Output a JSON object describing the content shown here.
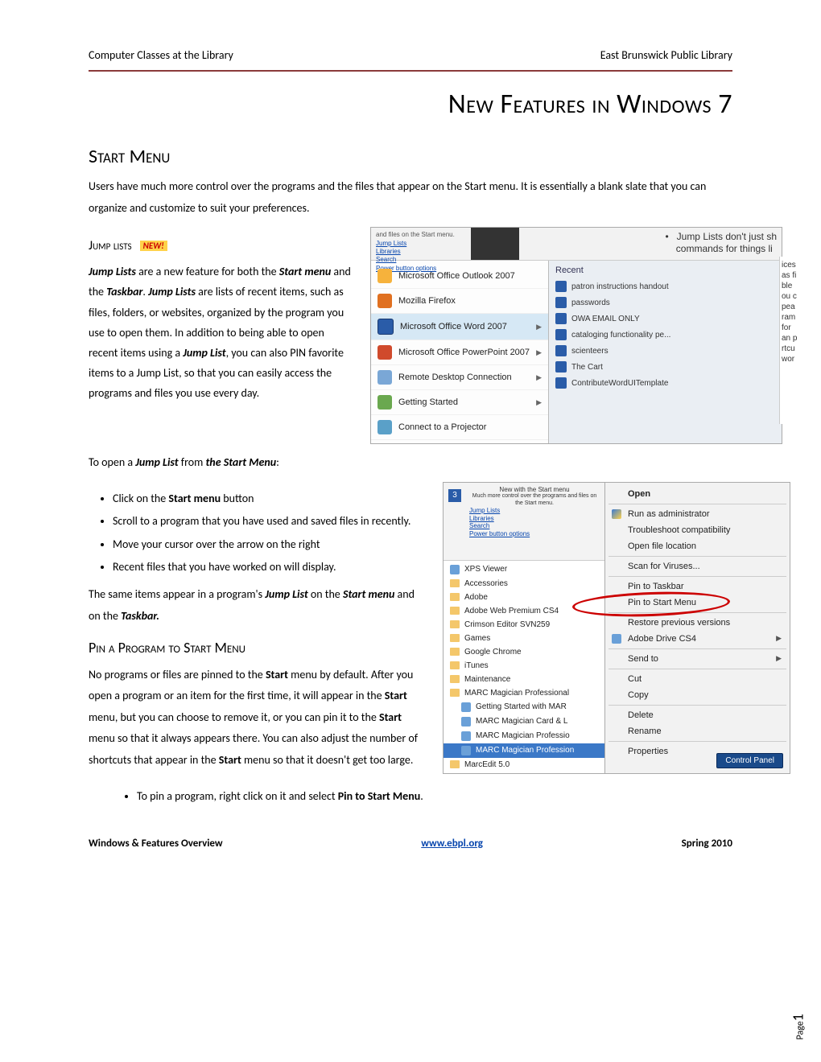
{
  "header": {
    "left": "Computer Classes at the Library",
    "right": "East Brunswick Public Library"
  },
  "title": "New Features in Windows 7",
  "sections": {
    "start_menu": {
      "heading": "Start Menu",
      "body": "Users have much more control over the programs and the files that appear on the Start menu.    It is essentially a blank slate that you can organize and customize to suit your preferences."
    },
    "jump_lists": {
      "heading": "Jump lists",
      "badge": "NEW!",
      "para": "Jump Lists are a new feature for both the Start menu and the Taskbar. Jump Lists are lists of recent items, such as files, folders, or websites, organized by the program you use to open them. In addition to being able to open recent items using a Jump List, you can also PIN favorite items to a Jump List, so that you can easily access the programs and files you use every day.",
      "to_open_label": "To open a Jump List from the Start Menu:",
      "steps": [
        "Click on the Start menu button",
        "Scroll to a program that you have used and saved files in recently.",
        "Move your cursor over the arrow on the right",
        "Recent files that you have worked on will display."
      ],
      "same_items": "The same items appear in a program's Jump List on the Start menu and on the Taskbar."
    },
    "pin": {
      "heading": "Pin a Program to Start Menu",
      "body": "No programs or files are pinned to the Start menu by default. After you open a program or an item for the first time, it will appear in the Start menu, but you can choose to remove it, or you can pin it to the Start menu so that it always appears there. You can also adjust the number of shortcuts that appear in the Start menu so that it doesn't get too large.",
      "step": "To pin a program, right click on it and select Pin to Start Menu."
    }
  },
  "shot1": {
    "topnote": "and files on the Start menu.",
    "toplinks": [
      "Jump Lists",
      "Libraries",
      "Search",
      "Power button options"
    ],
    "topright1": "Jump Lists don't just sh",
    "topright2": "commands for things li",
    "programs": [
      {
        "label": "Microsoft Office Outlook 2007",
        "icon": "ic-outlook",
        "arrow": false
      },
      {
        "label": "Mozilla Firefox",
        "icon": "ic-firefox",
        "arrow": false
      },
      {
        "label": "Microsoft Office Word 2007",
        "icon": "ic-word",
        "arrow": true,
        "hov": true
      },
      {
        "label": "Microsoft Office PowerPoint 2007",
        "icon": "ic-ppt",
        "arrow": true
      },
      {
        "label": "Remote Desktop Connection",
        "icon": "ic-rdp",
        "arrow": true
      },
      {
        "label": "Getting Started",
        "icon": "ic-gs",
        "arrow": true
      },
      {
        "label": "Connect to a Projector",
        "icon": "ic-proj",
        "arrow": false
      }
    ],
    "recent_heading": "Recent",
    "recent": [
      "patron instructions handout",
      "passwords",
      "OWA EMAIL ONLY",
      "cataloging functionality pe...",
      "scienteers",
      "The Cart",
      "ContributeWordUITemplate"
    ],
    "edge_words": [
      "ices",
      "as fi",
      "ble",
      "ou c",
      "pea",
      "ram",
      "for",
      "an p",
      "rtcu",
      "wor"
    ]
  },
  "shot2": {
    "topnum": "3",
    "toptitle": "New with the Start menu",
    "topsub": "Much more control over the programs and files on the Start menu.",
    "toplinks": [
      "Jump Lists",
      "Libraries",
      "Search",
      "Power button options"
    ],
    "left_items": [
      {
        "label": "XPS Viewer",
        "type": "app"
      },
      {
        "label": "Accessories",
        "type": "fld"
      },
      {
        "label": "Adobe",
        "type": "fld"
      },
      {
        "label": "Adobe Web Premium CS4",
        "type": "fld"
      },
      {
        "label": "Crimson Editor SVN259",
        "type": "fld"
      },
      {
        "label": "Games",
        "type": "fld"
      },
      {
        "label": "Google Chrome",
        "type": "fld"
      },
      {
        "label": "iTunes",
        "type": "fld"
      },
      {
        "label": "Maintenance",
        "type": "fld"
      },
      {
        "label": "MARC Magician Professional",
        "type": "fld"
      },
      {
        "label": "Getting Started with MAR",
        "type": "app",
        "indent": true
      },
      {
        "label": "MARC Magician Card & L",
        "type": "app",
        "indent": true
      },
      {
        "label": "MARC Magician Professio",
        "type": "app",
        "indent": true
      },
      {
        "label": "MARC Magician Profession",
        "type": "app",
        "indent": true,
        "sel": true
      },
      {
        "label": "MarcEdit 5.0",
        "type": "fld"
      }
    ],
    "ctx": [
      {
        "label": "Open",
        "bold": true
      },
      {
        "sep": true
      },
      {
        "label": "Run as administrator",
        "shield": true
      },
      {
        "label": "Troubleshoot compatibility"
      },
      {
        "label": "Open file location"
      },
      {
        "sep": true
      },
      {
        "label": "Scan for Viruses..."
      },
      {
        "sep": true
      },
      {
        "label": "Pin to Taskbar"
      },
      {
        "label": "Pin to Start Menu"
      },
      {
        "sep": true
      },
      {
        "label": "Restore previous versions"
      },
      {
        "label": "Adobe Drive CS4",
        "smic": true,
        "arrow": true
      },
      {
        "sep": true
      },
      {
        "label": "Send to",
        "arrow": true
      },
      {
        "sep": true
      },
      {
        "label": "Cut"
      },
      {
        "label": "Copy"
      },
      {
        "sep": true
      },
      {
        "label": "Delete"
      },
      {
        "label": "Rename"
      },
      {
        "sep": true
      },
      {
        "label": "Properties"
      }
    ],
    "control_panel": "Control Panel"
  },
  "footer": {
    "left": "Windows & Features Overview",
    "center": "www.ebpl.org",
    "right": "Spring 2010"
  },
  "page": {
    "label": "Page",
    "num": "1"
  }
}
